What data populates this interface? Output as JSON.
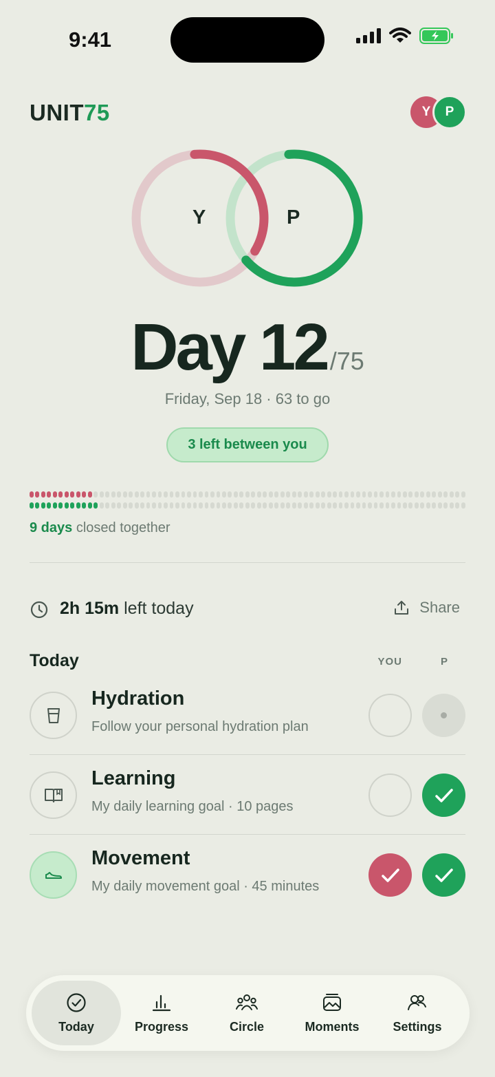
{
  "status": {
    "time": "9:41"
  },
  "brand": {
    "prefix": "UNIT",
    "accent": "75"
  },
  "avatars": {
    "you": "Y",
    "partner": "P"
  },
  "rings": {
    "you_label": "Y",
    "partner_label": "P",
    "you_progress": 0.35,
    "partner_progress": 0.65
  },
  "day": {
    "title": "Day 12",
    "total": "/75"
  },
  "date_line": "Friday, Sep 18 · 63 to go",
  "pill": "3 left between you",
  "streak": {
    "you_filled": 11,
    "partner_filled": 12,
    "total": 75,
    "days": "9 days",
    "caption": " closed together"
  },
  "time_left": {
    "value": "2h 15m",
    "suffix": " left today"
  },
  "share_label": "Share",
  "today": {
    "title": "Today",
    "col_you": "YOU",
    "col_p": "P"
  },
  "tasks": [
    {
      "title": "Hydration",
      "subtitle": "Follow your personal hydration plan",
      "icon": "cup-icon",
      "you": "empty",
      "partner": "pending"
    },
    {
      "title": "Learning",
      "subtitle": "My daily learning goal · 10 pages",
      "icon": "book-icon",
      "you": "empty",
      "partner": "done"
    },
    {
      "title": "Movement",
      "subtitle": "My daily movement goal · 45 minutes",
      "icon": "shoe-icon",
      "you": "done",
      "partner": "done"
    }
  ],
  "tabs": [
    {
      "label": "Today",
      "icon": "check-circle-icon",
      "active": true
    },
    {
      "label": "Progress",
      "icon": "bar-chart-icon",
      "active": false
    },
    {
      "label": "Circle",
      "icon": "people-icon",
      "active": false
    },
    {
      "label": "Moments",
      "icon": "photos-icon",
      "active": false
    },
    {
      "label": "Settings",
      "icon": "users-settings-icon",
      "active": false
    }
  ],
  "colors": {
    "you": "#C9566B",
    "partner": "#1FA25A",
    "you_track": "#E2C9CB",
    "partner_track": "#BFE2C8"
  }
}
